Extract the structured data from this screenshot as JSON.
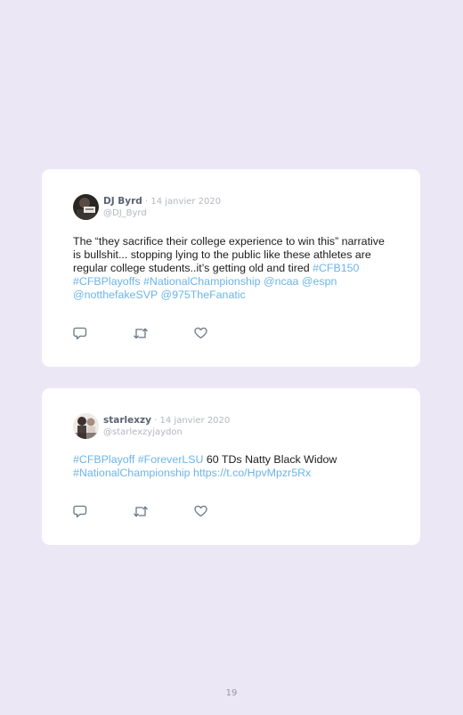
{
  "tweets": [
    {
      "display_name": "DJ Byrd",
      "separator": " · ",
      "date": "14 janvier 2020",
      "handle": "@DJ_Byrd",
      "text_parts": [
        "The “they sacrifice their college experience to win this” narrative is bullshit... stopping lying to the public like these athletes are regular college students..it’s getting old and tired ",
        "#CFB150",
        " ",
        "#CFBPlayoffs",
        " ",
        "#NationalChampionship",
        " ",
        "@ncaa",
        " ",
        "@espn",
        " ",
        "@notthefakeSVP",
        " ",
        "@975TheFanatic"
      ],
      "actions": [
        "reply-icon",
        "retweet-icon",
        "like-icon"
      ]
    },
    {
      "display_name": "starlexzy",
      "separator": " · ",
      "date": "14 janvier 2020",
      "handle": "@starlexzyjaydon",
      "text_parts": [
        "#CFBPlayoff",
        " ",
        "#ForeverLSU",
        " 60 TDs Natty Black Widow ",
        "#NationalChampionship",
        " ",
        "https://t.co/HpvMpzr5Rx"
      ],
      "actions": [
        "reply-icon",
        "retweet-icon",
        "like-icon"
      ]
    }
  ],
  "colors": {
    "background": "#ebe7f5",
    "card": "#ffffff",
    "link": "#6cb4e8",
    "icon": "#6b7580"
  },
  "page_number": "19"
}
